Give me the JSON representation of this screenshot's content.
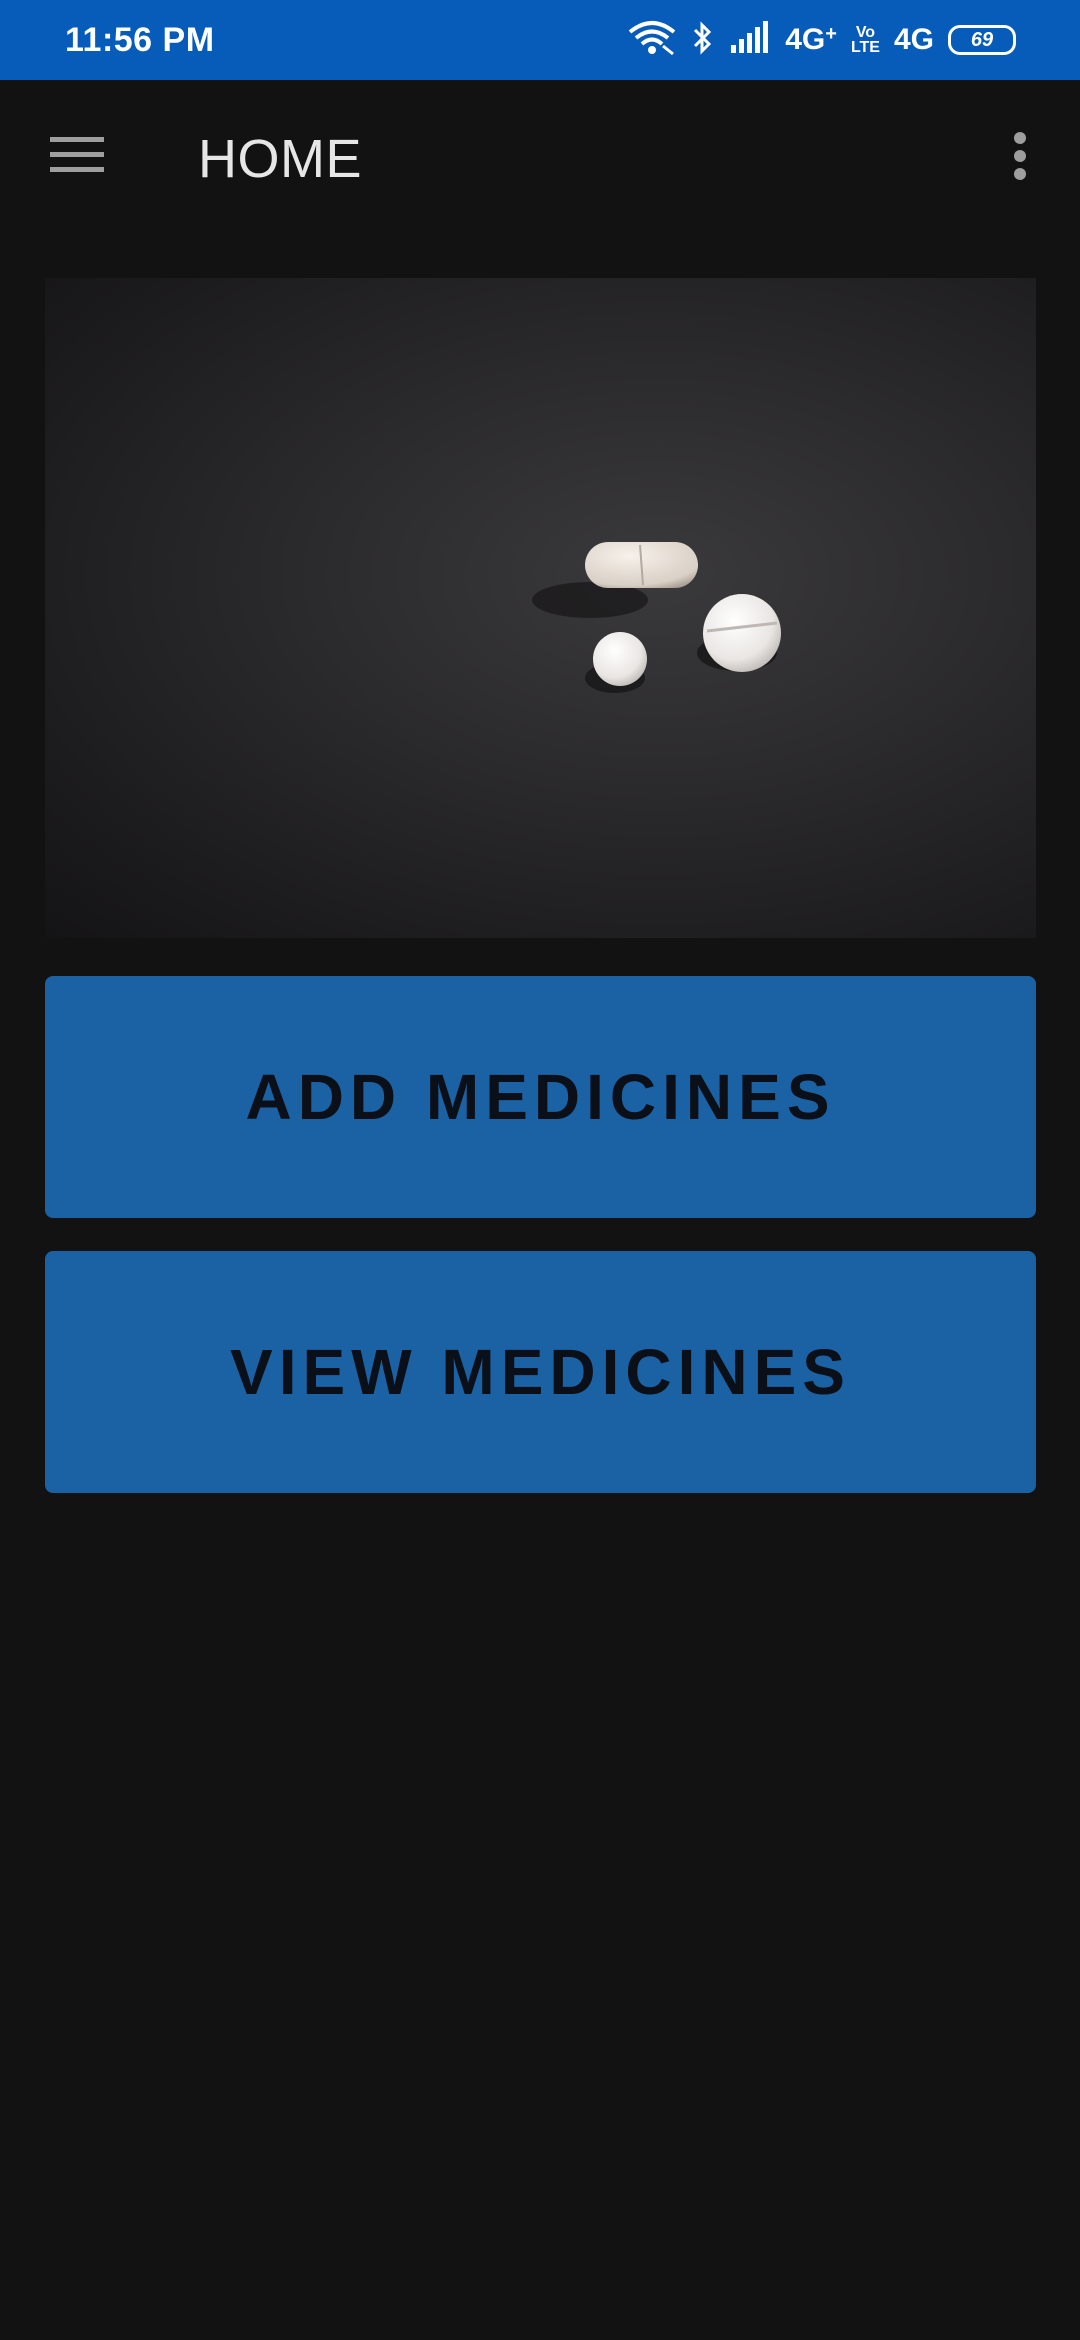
{
  "status_bar": {
    "time": "11:56 PM",
    "network_1": "4G",
    "network_1_sub": "+",
    "volte_top": "Vo",
    "volte_bottom": "LTE",
    "network_2": "4G",
    "battery": "69",
    "background_color": "#075bb9"
  },
  "app_bar": {
    "title": "HOME",
    "menu_icon": "hamburger-menu-icon",
    "overflow_icon": "more-vert-icon"
  },
  "hero_image": {
    "description_icon": "pills-photo"
  },
  "buttons": {
    "add_label": "ADD MEDICINES",
    "view_label": "VIEW MEDICINES",
    "color": "#1b62a5"
  }
}
